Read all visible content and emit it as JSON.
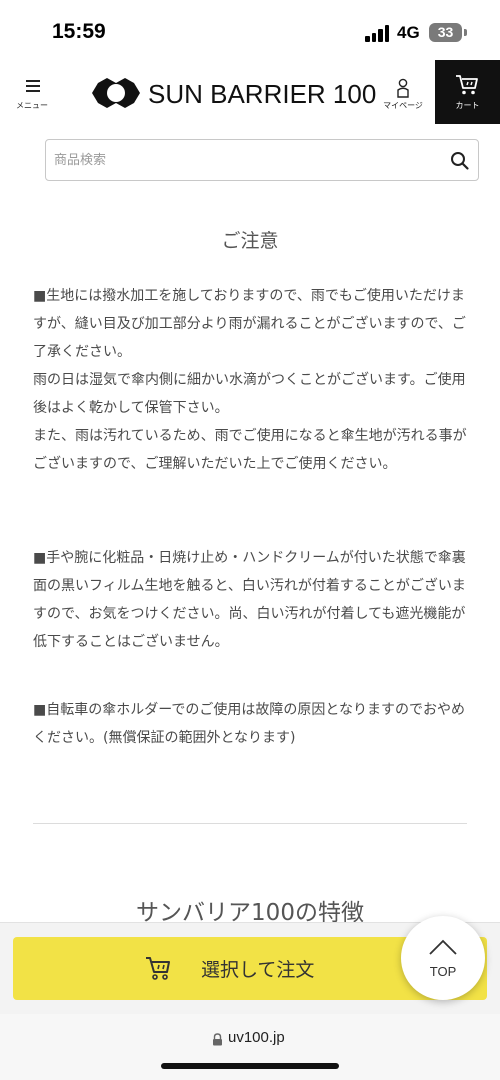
{
  "status": {
    "time": "15:59",
    "network": "4G",
    "battery": "33"
  },
  "header": {
    "menu_label": "メニュー",
    "logo_text": "SUN BARRIER 100",
    "mypage_label": "マイページ",
    "cart_label": "カート",
    "icons": [
      "menu-icon",
      "logo-mark-icon",
      "person-icon",
      "cart-icon"
    ]
  },
  "search": {
    "placeholder": "商品検索",
    "value": "",
    "icon": "search-icon"
  },
  "main": {
    "title": "ご注意",
    "paragraphs": [
      "■生地には撥水加工を施しておりますので、雨でもご使用いただけますが、縫い目及び加工部分より雨が漏れることがございますので、ご了承ください。\n雨の日は湿気で傘内側に細かい水滴がつくことがございます。ご使用後はよく乾かして保管下さい。\nまた、雨は汚れているため、雨でご使用になると傘生地が汚れる事がございますので、ご理解いただいた上でご使用ください。",
      "■手や腕に化粧品・日焼け止め・ハンドクリームが付いた状態で傘裏面の黒いフィルム生地を触ると、白い汚れが付着することがございますので、お気をつけください。尚、白い汚れが付着しても遮光機能が低下することはございません。",
      "■自転車の傘ホルダーでのご使用は故障の原因となりますのでおやめください。(無償保証の範囲外となります)"
    ],
    "features_title": "サンバリア100の特徴"
  },
  "bottom": {
    "order_label": "選択して注文",
    "top_label": "TOP",
    "button_color": "#f2e246"
  },
  "browser": {
    "url": "uv100.jp"
  }
}
